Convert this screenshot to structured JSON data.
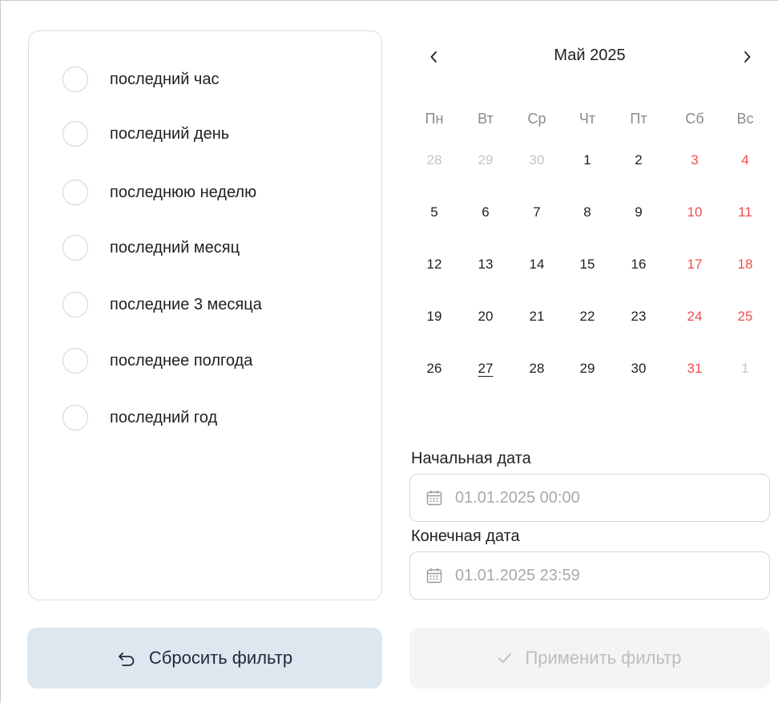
{
  "presets": [
    {
      "label": "последний час"
    },
    {
      "label": "последний день"
    },
    {
      "label": "последнюю неделю"
    },
    {
      "label": "последний месяц"
    },
    {
      "label": "последние 3 месяца"
    },
    {
      "label": "последнее полгода"
    },
    {
      "label": "последний год"
    }
  ],
  "calendar": {
    "month_title": "Май 2025",
    "prev_icon": "chevron-left-icon",
    "next_icon": "chevron-right-icon",
    "weekdays": [
      "Пн",
      "Вт",
      "Ср",
      "Чт",
      "Пт",
      "Сб",
      "Вс"
    ],
    "weeks": [
      [
        "28",
        "29",
        "30",
        "1",
        "2",
        "3",
        "4"
      ],
      [
        "5",
        "6",
        "7",
        "8",
        "9",
        "10",
        "11"
      ],
      [
        "12",
        "13",
        "14",
        "15",
        "16",
        "17",
        "18"
      ],
      [
        "19",
        "20",
        "21",
        "22",
        "23",
        "24",
        "25"
      ],
      [
        "26",
        "27",
        "28",
        "29",
        "30",
        "31",
        "1"
      ]
    ],
    "today": "27",
    "colors": {
      "weekend": "#ee4d4d",
      "muted": "#c4c4c4"
    }
  },
  "start_date": {
    "label": "Начальная дата",
    "placeholder": "01.01.2025 00:00",
    "value": ""
  },
  "end_date": {
    "label": "Конечная дата",
    "placeholder": "01.01.2025 23:59",
    "value": ""
  },
  "actions": {
    "reset_label": "Сбросить фильтр",
    "reset_icon": "undo-icon",
    "apply_label": "Применить фильтр",
    "apply_icon": "checkmark-icon"
  },
  "colors": {
    "reset_bg": "#dce7f0",
    "apply_bg": "#f3f4f5"
  }
}
